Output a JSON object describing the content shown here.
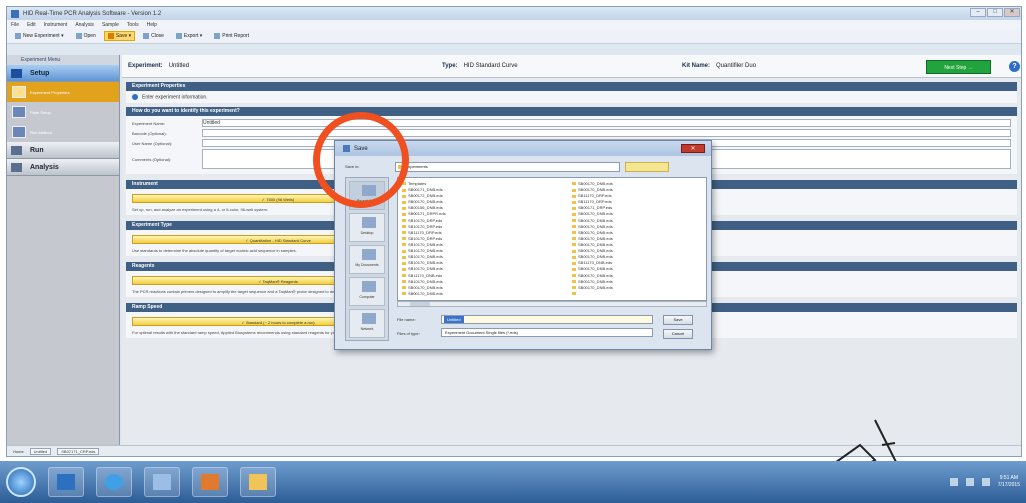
{
  "window": {
    "title": "HID Real-Time PCR Analysis Software - Version 1.2",
    "controls": [
      "–",
      "□",
      "✕"
    ]
  },
  "menu": [
    "File",
    "Edit",
    "Instrument",
    "Analysis",
    "Sample",
    "Tools",
    "Help"
  ],
  "toolbar": {
    "items": [
      {
        "label": "New Experiment ▾",
        "icon": "new-experiment-icon"
      },
      {
        "label": "Open",
        "icon": "open-folder-icon"
      },
      {
        "label": "Save ▾",
        "icon": "save-icon",
        "active": true
      },
      {
        "label": "Close",
        "icon": "close-icon"
      },
      {
        "label": "Export ▾",
        "icon": "export-icon"
      },
      {
        "label": "Print Report",
        "icon": "print-icon"
      }
    ]
  },
  "sidebar": {
    "header": "Experiment Menu",
    "setup": "Setup",
    "sub_items": [
      {
        "label": "Experiment Properties",
        "selected": true
      },
      {
        "label": "Plate Setup",
        "selected": false
      },
      {
        "label": "Run Method",
        "selected": false
      }
    ],
    "run": "Run",
    "analysis": "Analysis"
  },
  "experiment": {
    "label": "Experiment:",
    "name": "Untitled",
    "type_label": "Type:",
    "type": "HID Standard Curve",
    "kit_label": "Kit Name:",
    "kit": "Quantifiler Duo",
    "next_button": "Next Step →",
    "help": "?"
  },
  "sections": {
    "properties": "Experiment Properties",
    "properties_hint": "Enter experiment information.",
    "identify": "How do you want to identify this experiment?",
    "fields": [
      {
        "label": "Experiment Name:",
        "value": "Untitled"
      },
      {
        "label": "Barcode (Optional):",
        "value": ""
      },
      {
        "label": "User Name (Optional):",
        "value": ""
      },
      {
        "label": "Comments (Optional):",
        "value": ""
      }
    ],
    "instrument": "Instrument",
    "instrument_btn": "✓ 7500 (96 Wells)",
    "instrument_desc": "Set up, run, and analyze an experiment using a 4- or 5-color, 96-well system.",
    "exp_type": "Experiment Type",
    "exp_type_btn": "✓ Quantitation - HID Standard Curve",
    "exp_type_desc": "Use standards to determine the absolute quantity of target nucleic acid sequence in samples.",
    "reagents": "Reagents",
    "reagents_btn": "✓ TaqMan® Reagents",
    "reagents_desc": "The PCR reactions contain primers designed to amplify the target sequence and a TaqMan® probe designed to detect amplification of the target sequence.",
    "ramp": "Ramp Speed",
    "ramp_btn": "✓ Standard (~ 2 hours to complete a run)",
    "ramp_desc": "For optimal results with the standard ramp speed, Applied Biosystems recommends using standard reagents for your PCR reactions."
  },
  "statusbar": {
    "home": "Home",
    "tabs": [
      "Untitled",
      "SB07171_CRP.eds"
    ]
  },
  "dialog": {
    "title": "Save",
    "close": "✕",
    "save_in_label": "Save in:",
    "save_in_value": "experiments",
    "places": [
      "Recent Items",
      "Desktop",
      "My Documents",
      "Computer",
      "Network"
    ],
    "files_left": [
      "Templates",
      "SB00171_DNB.eds",
      "SB00172_DNB.eds",
      "SB00170_DNB.eds",
      "SB00156_DNB.eds",
      "SB00171_DRPR.eds",
      "SB10170_DRP.eds",
      "SB10170_DRP.eds",
      "SB11170_DRP.eds",
      "SB10170_DRP.eds",
      "SB10170_DNB.eds",
      "SB10170_DNB.eds",
      "SB10170_DNB.eds",
      "SB10170_DNB.eds",
      "SB10170_DNB.eds",
      "SB11170_DNB.eds",
      "SB10170_DNB.eds",
      "SB00170_DNB.eds",
      "SB00170_DNB.eds"
    ],
    "files_right": [
      "SB00170_DNB.eds",
      "SB00170_DNB.eds",
      "SB11170_DRP.eds",
      "SB11170_DRP.eds",
      "SB00171_DRP.eds",
      "SB00170_DNB.eds",
      "SB00170_DNB.eds",
      "SB00170_DNB.eds",
      "SB00170_DNB.eds",
      "SB00170_DNB.eds",
      "SB00170_DNB.eds",
      "SB00170_DNB.eds",
      "SB00170_DNB.eds",
      "SB11170_DNB.eds",
      "SB00170_DNB.eds",
      "SB00170_DNB.eds",
      "SB00170_DNB.eds",
      "SB00170_DNB.eds"
    ],
    "file_name_label": "File name:",
    "file_name_value": "Untitled",
    "file_type_label": "Files of type:",
    "file_type_value": "Experiment Document Single files (*.eds)",
    "save_btn": "Save",
    "cancel_btn": "Cancel"
  },
  "taskbar": {
    "clock_time": "9:51 AM",
    "clock_date": "7/17/2015"
  },
  "colors": {
    "callout": "#f04f1f",
    "next_button": "#21a33d",
    "section_bar": "#3f5f84"
  }
}
